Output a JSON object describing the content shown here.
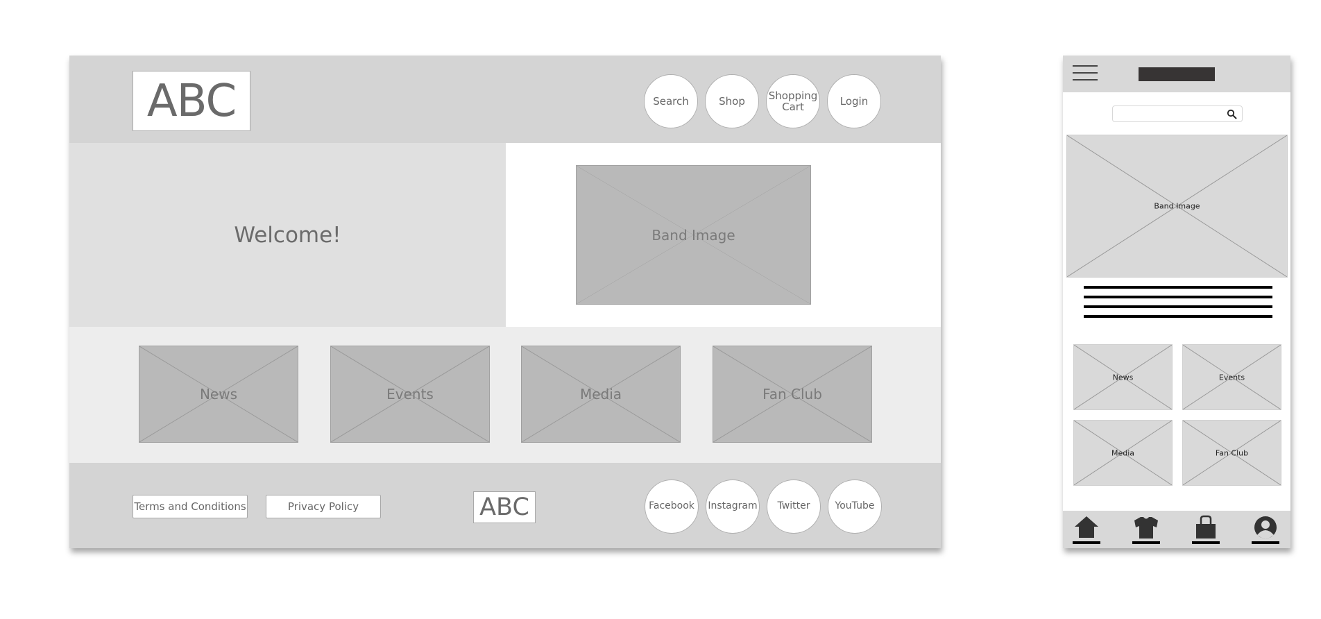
{
  "desktop": {
    "header": {
      "logo_text": "ABC",
      "nav_buttons": [
        {
          "label": "Search"
        },
        {
          "label": "Shop"
        },
        {
          "label": "Shopping Cart"
        },
        {
          "label": "Login"
        }
      ]
    },
    "hero": {
      "welcome_text": "Welcome!",
      "image_label": "Band Image"
    },
    "tiles": [
      {
        "label": "News"
      },
      {
        "label": "Events"
      },
      {
        "label": "Media"
      },
      {
        "label": "Fan Club"
      }
    ],
    "footer": {
      "links": [
        {
          "label": "Terms and Conditions"
        },
        {
          "label": "Privacy Policy"
        }
      ],
      "logo_text": "ABC",
      "social_buttons": [
        {
          "label": "Facebook"
        },
        {
          "label": "Instagram"
        },
        {
          "label": "Twitter"
        },
        {
          "label": "YouTube"
        }
      ]
    }
  },
  "mobile": {
    "header": {
      "menu_icon": "hamburger-icon",
      "logo": "logo-placeholder"
    },
    "search": {
      "placeholder": "",
      "icon": "search-icon"
    },
    "hero_image_label": "Band Image",
    "tiles": [
      {
        "label": "News"
      },
      {
        "label": "Events"
      },
      {
        "label": "Media"
      },
      {
        "label": "Fan Club"
      }
    ],
    "bottom_nav": [
      {
        "icon": "home-icon"
      },
      {
        "icon": "shirt-icon"
      },
      {
        "icon": "bag-icon"
      },
      {
        "icon": "user-icon"
      }
    ]
  }
}
